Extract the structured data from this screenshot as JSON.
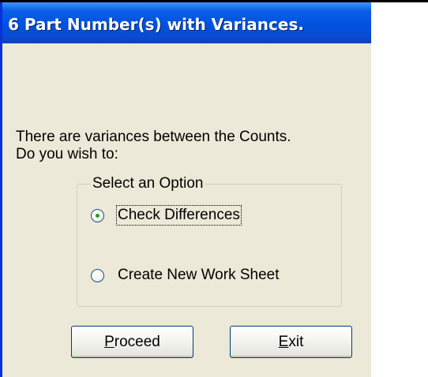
{
  "window": {
    "title": "6 Part Number(s) with Variances."
  },
  "message": {
    "line1": "There are variances between the Counts.",
    "line2": "Do you wish to:"
  },
  "options_group": {
    "legend": "Select an Option",
    "options": [
      {
        "label": "Check Differences",
        "selected": true,
        "focused": true
      },
      {
        "label": "Create New Work Sheet",
        "selected": false,
        "focused": false
      }
    ]
  },
  "buttons": {
    "proceed": {
      "mnemonic": "P",
      "rest": "roceed"
    },
    "exit": {
      "mnemonic": "E",
      "rest": "xit"
    }
  },
  "colors": {
    "title_bar": "#0055e5",
    "dialog_background": "#ece9d8",
    "radio_selected_dot": "#21a121",
    "button_border": "#003c74"
  }
}
